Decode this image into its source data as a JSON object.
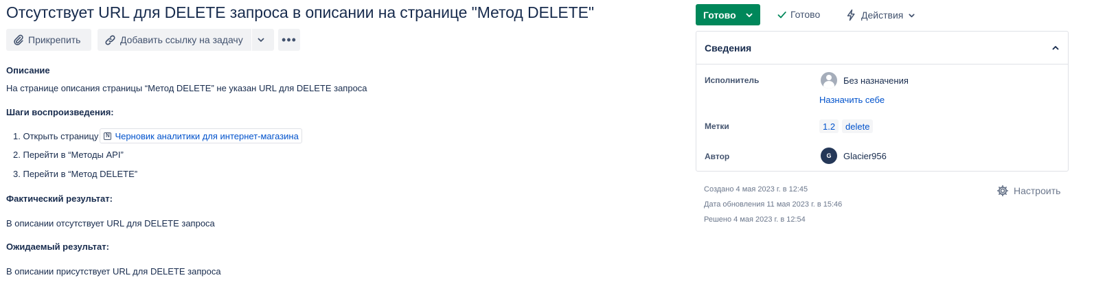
{
  "issue": {
    "title": "Отсутствует URL для DELETE запроса в описании на странице \"Метод DELETE\""
  },
  "toolbar": {
    "attach_label": "Прикрепить",
    "link_label": "Добавить ссылку на задачу",
    "more_label": "•••"
  },
  "description": {
    "label": "Описание",
    "summary": "На странице описания страницы “Метод DELETE” не указан URL для DELETE запроса",
    "steps_heading": "Шаги воспроизведения:",
    "steps": [
      {
        "number": "1.",
        "text": "Открыть страницу",
        "link": "Черновик аналитики для интернет-магазина",
        "link_icon": "notion-icon"
      },
      {
        "number": "2.",
        "text": "Перейти в “Методы API”"
      },
      {
        "number": "3.",
        "text": "Перейти в “Метод DELETE”"
      }
    ],
    "actual_heading": "Фактический результат:",
    "actual_text": "В описании отсутствует URL для DELETE запроса",
    "expected_heading": "Ожидаемый результат:",
    "expected_text": "В описании присутствует URL для DELETE запроса"
  },
  "status": {
    "button_label": "Готово",
    "resolution_label": "Готово",
    "actions_label": "Действия",
    "button_color": "#00875a"
  },
  "details": {
    "title": "Сведения",
    "assignee_label": "Исполнитель",
    "assignee_value": "Без назначения",
    "assign_self": "Назначить себе",
    "labels_label": "Метки",
    "labels": [
      "1.2",
      "delete"
    ],
    "reporter_label": "Автор",
    "reporter_initial": "G",
    "reporter_name": "Glacier956"
  },
  "meta": {
    "created": "Создано 4 мая 2023 г. в 12:45",
    "updated": "Дата обновления 11 мая 2023 г. в 15:46",
    "resolved": "Решено 4 мая 2023 г. в 12:54",
    "configure_label": "Настроить"
  }
}
